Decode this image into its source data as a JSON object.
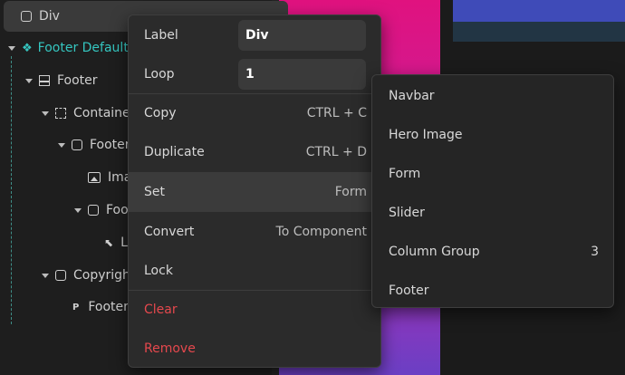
{
  "tree": {
    "items": [
      {
        "label": "Div"
      },
      {
        "label": "Footer Default"
      },
      {
        "label": "Footer"
      },
      {
        "label": "Container"
      },
      {
        "label": "Footer"
      },
      {
        "label": "Image"
      },
      {
        "label": "Footer"
      },
      {
        "label": "Link"
      },
      {
        "label": "Copyright"
      },
      {
        "label": "Footer"
      }
    ]
  },
  "context_menu": {
    "label_caption": "Label",
    "label_value": "Div",
    "loop_caption": "Loop",
    "loop_value": "1",
    "copy": {
      "label": "Copy",
      "shortcut": "CTRL + C"
    },
    "duplicate": {
      "label": "Duplicate",
      "shortcut": "CTRL + D"
    },
    "set": {
      "label": "Set",
      "value": "Form"
    },
    "convert": {
      "label": "Convert",
      "value": "To Component"
    },
    "lock": {
      "label": "Lock"
    },
    "clear": {
      "label": "Clear"
    },
    "remove": {
      "label": "Remove"
    }
  },
  "submenu": {
    "items": [
      {
        "label": "Navbar"
      },
      {
        "label": "Hero Image"
      },
      {
        "label": "Form"
      },
      {
        "label": "Slider"
      },
      {
        "label": "Column Group",
        "count": "3"
      },
      {
        "label": "Footer"
      }
    ]
  },
  "colors": {
    "accent_teal": "#35c6c0",
    "danger": "#e5484d",
    "canvas_magenta": "#e0127f",
    "canvas_blue": "#3f4bb8"
  }
}
